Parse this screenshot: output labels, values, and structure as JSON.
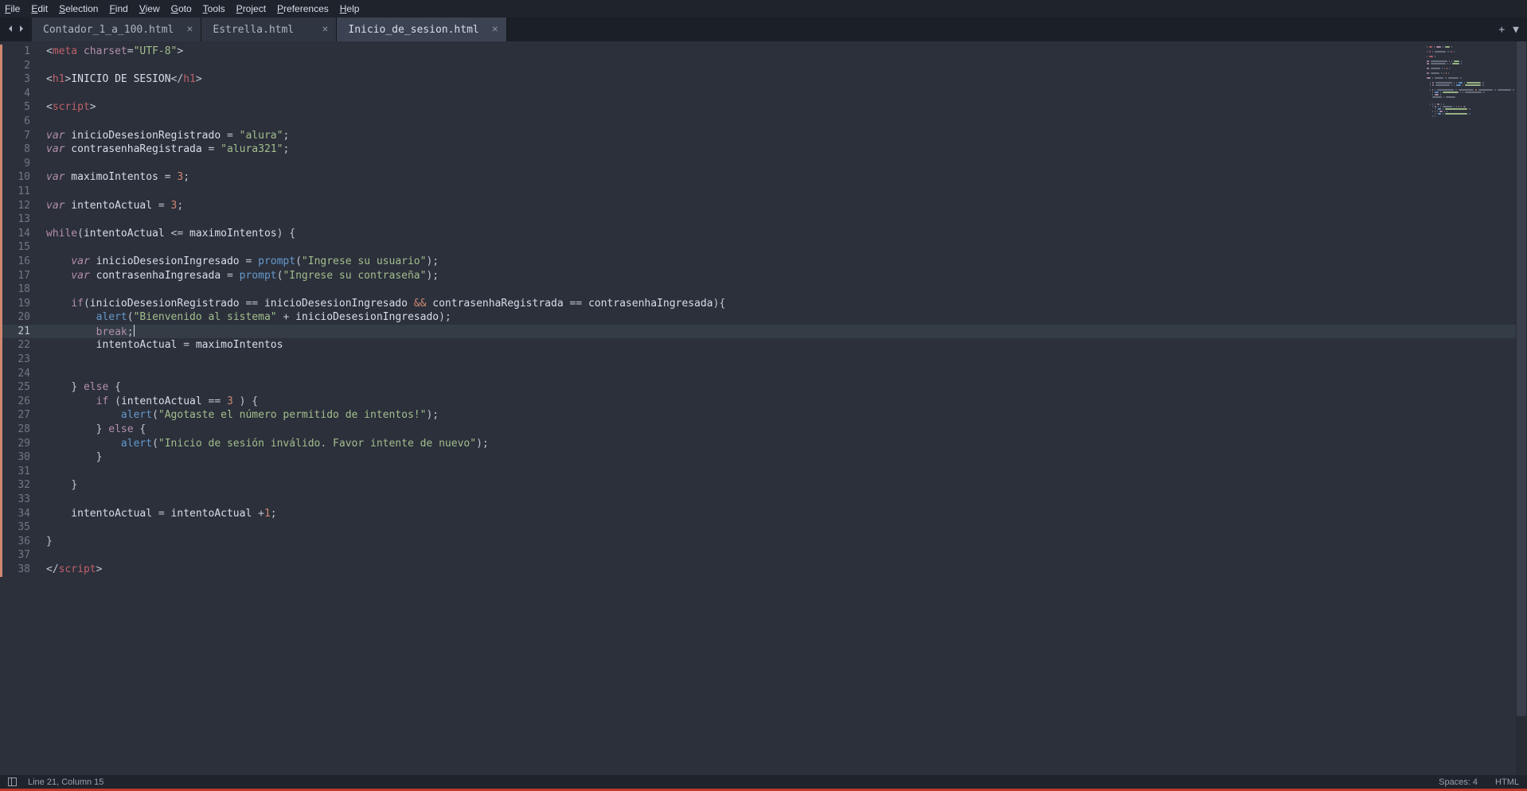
{
  "menu": {
    "items": [
      "File",
      "Edit",
      "Selection",
      "Find",
      "View",
      "Goto",
      "Tools",
      "Project",
      "Preferences",
      "Help"
    ]
  },
  "tabs": {
    "items": [
      {
        "label": "Contador_1_a_100.html",
        "active": false
      },
      {
        "label": "Estrella.html",
        "active": false
      },
      {
        "label": "Inicio_de_sesion.html",
        "active": true
      }
    ]
  },
  "editor": {
    "line_count": 38,
    "highlighted_line": 21,
    "modified_from_line": 1,
    "modified_to_line": 38,
    "tokens": [
      [
        {
          "t": "tag-ang",
          "v": "<"
        },
        {
          "t": "tag-name",
          "v": "meta"
        },
        {
          "t": "ident",
          "v": " "
        },
        {
          "t": "attr",
          "v": "charset"
        },
        {
          "t": "op",
          "v": "="
        },
        {
          "t": "str",
          "v": "\"UTF-8\""
        },
        {
          "t": "tag-ang",
          "v": ">"
        }
      ],
      [],
      [
        {
          "t": "tag-ang",
          "v": "<"
        },
        {
          "t": "tag-name",
          "v": "h1"
        },
        {
          "t": "tag-ang",
          "v": ">"
        },
        {
          "t": "ident",
          "v": "INICIO DE SESION"
        },
        {
          "t": "tag-ang",
          "v": "</"
        },
        {
          "t": "tag-name",
          "v": "h1"
        },
        {
          "t": "tag-ang",
          "v": ">"
        }
      ],
      [],
      [
        {
          "t": "tag-ang",
          "v": "<"
        },
        {
          "t": "tag-name",
          "v": "script"
        },
        {
          "t": "tag-ang",
          "v": ">"
        }
      ],
      [],
      [
        {
          "t": "kw",
          "v": "var"
        },
        {
          "t": "ident",
          "v": " inicioDesesionRegistrado "
        },
        {
          "t": "op",
          "v": "="
        },
        {
          "t": "ident",
          "v": " "
        },
        {
          "t": "str",
          "v": "\"alura\""
        },
        {
          "t": "op",
          "v": ";"
        }
      ],
      [
        {
          "t": "kw",
          "v": "var"
        },
        {
          "t": "ident",
          "v": " contrasenhaRegistrada "
        },
        {
          "t": "op",
          "v": "="
        },
        {
          "t": "ident",
          "v": " "
        },
        {
          "t": "str",
          "v": "\"alura321\""
        },
        {
          "t": "op",
          "v": ";"
        }
      ],
      [],
      [
        {
          "t": "kw",
          "v": "var"
        },
        {
          "t": "ident",
          "v": " maximoIntentos "
        },
        {
          "t": "op",
          "v": "="
        },
        {
          "t": "ident",
          "v": " "
        },
        {
          "t": "num",
          "v": "3"
        },
        {
          "t": "op",
          "v": ";"
        }
      ],
      [],
      [
        {
          "t": "kw",
          "v": "var"
        },
        {
          "t": "ident",
          "v": " intentoActual "
        },
        {
          "t": "op",
          "v": "="
        },
        {
          "t": "ident",
          "v": " "
        },
        {
          "t": "num",
          "v": "3"
        },
        {
          "t": "op",
          "v": ";"
        }
      ],
      [],
      [
        {
          "t": "kw2",
          "v": "while"
        },
        {
          "t": "op",
          "v": "("
        },
        {
          "t": "ident",
          "v": "intentoActual "
        },
        {
          "t": "op",
          "v": "<="
        },
        {
          "t": "ident",
          "v": " maximoIntentos"
        },
        {
          "t": "op",
          "v": ") {"
        }
      ],
      [],
      [
        {
          "t": "ident",
          "v": "    "
        },
        {
          "t": "kw",
          "v": "var"
        },
        {
          "t": "ident",
          "v": " inicioDesesionIngresado "
        },
        {
          "t": "op",
          "v": "="
        },
        {
          "t": "ident",
          "v": " "
        },
        {
          "t": "fn",
          "v": "prompt"
        },
        {
          "t": "op",
          "v": "("
        },
        {
          "t": "str",
          "v": "\"Ingrese su usuario\""
        },
        {
          "t": "op",
          "v": ");"
        }
      ],
      [
        {
          "t": "ident",
          "v": "    "
        },
        {
          "t": "kw",
          "v": "var"
        },
        {
          "t": "ident",
          "v": " contrasenhaIngresada "
        },
        {
          "t": "op",
          "v": "="
        },
        {
          "t": "ident",
          "v": " "
        },
        {
          "t": "fn",
          "v": "prompt"
        },
        {
          "t": "op",
          "v": "("
        },
        {
          "t": "str",
          "v": "\"Ingrese su contraseña\""
        },
        {
          "t": "op",
          "v": ");"
        }
      ],
      [],
      [
        {
          "t": "ident",
          "v": "    "
        },
        {
          "t": "kw2",
          "v": "if"
        },
        {
          "t": "op",
          "v": "("
        },
        {
          "t": "ident",
          "v": "inicioDesesionRegistrado "
        },
        {
          "t": "op",
          "v": "=="
        },
        {
          "t": "ident",
          "v": " inicioDesesionIngresado "
        },
        {
          "t": "bool",
          "v": "&&"
        },
        {
          "t": "ident",
          "v": " contrasenhaRegistrada "
        },
        {
          "t": "op",
          "v": "=="
        },
        {
          "t": "ident",
          "v": " contrasenhaIngresada"
        },
        {
          "t": "op",
          "v": "){"
        }
      ],
      [
        {
          "t": "ident",
          "v": "        "
        },
        {
          "t": "fn",
          "v": "alert"
        },
        {
          "t": "op",
          "v": "("
        },
        {
          "t": "str",
          "v": "\"Bienvenido al sistema\""
        },
        {
          "t": "ident",
          "v": " "
        },
        {
          "t": "op",
          "v": "+"
        },
        {
          "t": "ident",
          "v": " inicioDesesionIngresado"
        },
        {
          "t": "op",
          "v": ");"
        }
      ],
      [
        {
          "t": "ident",
          "v": "        "
        },
        {
          "t": "kw2",
          "v": "break"
        },
        {
          "t": "op",
          "v": ";"
        },
        {
          "t": "caret",
          "v": ""
        }
      ],
      [
        {
          "t": "ident",
          "v": "        intentoActual "
        },
        {
          "t": "op",
          "v": "="
        },
        {
          "t": "ident",
          "v": " maximoIntentos"
        }
      ],
      [],
      [],
      [
        {
          "t": "ident",
          "v": "    "
        },
        {
          "t": "op",
          "v": "}"
        },
        {
          "t": "ident",
          "v": " "
        },
        {
          "t": "kw2",
          "v": "else"
        },
        {
          "t": "ident",
          "v": " "
        },
        {
          "t": "op",
          "v": "{"
        }
      ],
      [
        {
          "t": "ident",
          "v": "        "
        },
        {
          "t": "kw2",
          "v": "if"
        },
        {
          "t": "ident",
          "v": " "
        },
        {
          "t": "op",
          "v": "("
        },
        {
          "t": "ident",
          "v": "intentoActual "
        },
        {
          "t": "op",
          "v": "=="
        },
        {
          "t": "ident",
          "v": " "
        },
        {
          "t": "num",
          "v": "3"
        },
        {
          "t": "ident",
          "v": " "
        },
        {
          "t": "op",
          "v": ") {"
        }
      ],
      [
        {
          "t": "ident",
          "v": "            "
        },
        {
          "t": "fn",
          "v": "alert"
        },
        {
          "t": "op",
          "v": "("
        },
        {
          "t": "str",
          "v": "\"Agotaste el número permitido de intentos!\""
        },
        {
          "t": "op",
          "v": ");"
        }
      ],
      [
        {
          "t": "ident",
          "v": "        "
        },
        {
          "t": "op",
          "v": "}"
        },
        {
          "t": "ident",
          "v": " "
        },
        {
          "t": "kw2",
          "v": "else"
        },
        {
          "t": "ident",
          "v": " "
        },
        {
          "t": "op",
          "v": "{"
        }
      ],
      [
        {
          "t": "ident",
          "v": "            "
        },
        {
          "t": "fn",
          "v": "alert"
        },
        {
          "t": "op",
          "v": "("
        },
        {
          "t": "str",
          "v": "\"Inicio de sesión inválido. Favor intente de nuevo\""
        },
        {
          "t": "op",
          "v": ");"
        }
      ],
      [
        {
          "t": "ident",
          "v": "        "
        },
        {
          "t": "op",
          "v": "}"
        }
      ],
      [],
      [
        {
          "t": "ident",
          "v": "    "
        },
        {
          "t": "op",
          "v": "}"
        }
      ],
      [],
      [
        {
          "t": "ident",
          "v": "    intentoActual "
        },
        {
          "t": "op",
          "v": "="
        },
        {
          "t": "ident",
          "v": " intentoActual "
        },
        {
          "t": "op",
          "v": "+"
        },
        {
          "t": "num",
          "v": "1"
        },
        {
          "t": "op",
          "v": ";"
        }
      ],
      [],
      [
        {
          "t": "op",
          "v": "}"
        }
      ],
      [],
      [
        {
          "t": "tag-ang",
          "v": "</"
        },
        {
          "t": "tag-name",
          "v": "script"
        },
        {
          "t": "tag-ang",
          "v": ">"
        }
      ]
    ]
  },
  "statusbar": {
    "cursor": "Line 21, Column 15",
    "spaces": "Spaces: 4",
    "syntax": "HTML"
  },
  "minimap_colors": {
    "tag": "#bf616a",
    "str": "#a3be8c",
    "kw": "#b48ead",
    "fn": "#6699cc",
    "id": "#6b7280",
    "num": "#d08770"
  }
}
